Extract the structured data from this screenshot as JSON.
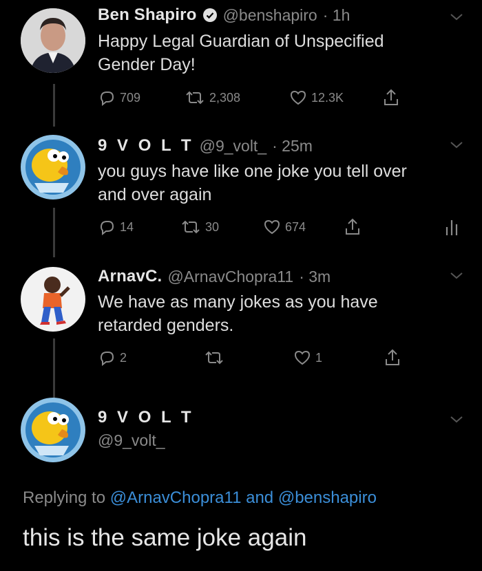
{
  "tweets": [
    {
      "name": "Ben Shapiro",
      "handle": "@benshapiro",
      "time": "· 1h",
      "text_lines": [
        "Happy Legal Guardian of Unspecified",
        "Gender Day!"
      ],
      "replies": "709",
      "retweets": "2,308",
      "likes": "12.3K"
    },
    {
      "name": "9 V O L T",
      "handle": "@9_volt_",
      "time": "· 25m",
      "text_lines": [
        "you guys have like one joke you tell over",
        "and over again"
      ],
      "replies": "14",
      "retweets": "30",
      "likes": "674"
    },
    {
      "name": "ArnavC.",
      "handle": "@ArnavChopra11",
      "time": "· 3m",
      "text_lines": [
        "We have as many jokes as you have",
        "retarded genders."
      ],
      "replies": "2",
      "retweets": "",
      "likes": "1"
    }
  ],
  "main_tweet": {
    "name": "9 V O L T",
    "handle": "@9_volt_",
    "replying_prefix": "Replying to",
    "replying_mention_1": "@ArnavChopra11",
    "replying_and": "and",
    "replying_mention_2": "@benshapiro",
    "text": "this is the same joke again"
  },
  "colors": {
    "background": "#000000",
    "mention_blue": "#3b8ed8",
    "muted_gray": "#8a8a8a",
    "verified_blue": "#e0e0e0"
  },
  "icons": [
    "reply-icon",
    "retweet-icon",
    "like-icon",
    "share-icon",
    "analytics-icon",
    "chevron-down-icon",
    "verified-badge-icon"
  ]
}
